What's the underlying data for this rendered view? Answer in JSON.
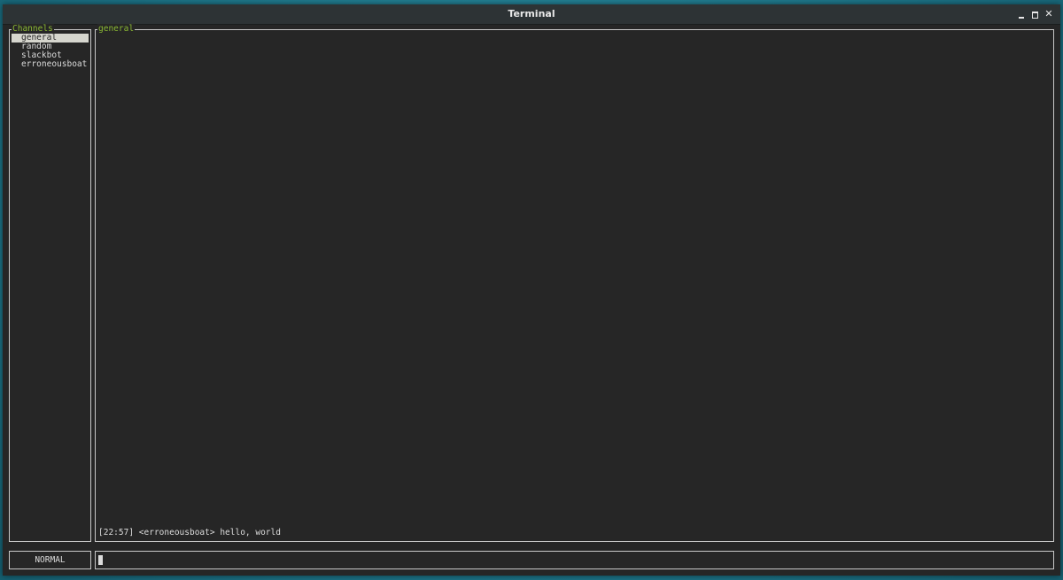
{
  "window": {
    "title": "Terminal"
  },
  "channels_pane": {
    "title": "Channels",
    "items": [
      {
        "label": "general",
        "selected": true
      },
      {
        "label": "random",
        "selected": false
      },
      {
        "label": "slackbot",
        "selected": false
      },
      {
        "label": "erroneousboat",
        "selected": false
      }
    ]
  },
  "messages_pane": {
    "title": "general",
    "messages": [
      {
        "time": "[22:57]",
        "user": "<erroneousboat>",
        "text": "hello, world"
      }
    ]
  },
  "mode": {
    "label": "NORMAL"
  },
  "input": {
    "value": ""
  },
  "colors": {
    "accent": "#8ab833",
    "background": "#262626",
    "border": "#c8c8c8",
    "selected_bg": "#d6d6ce"
  }
}
